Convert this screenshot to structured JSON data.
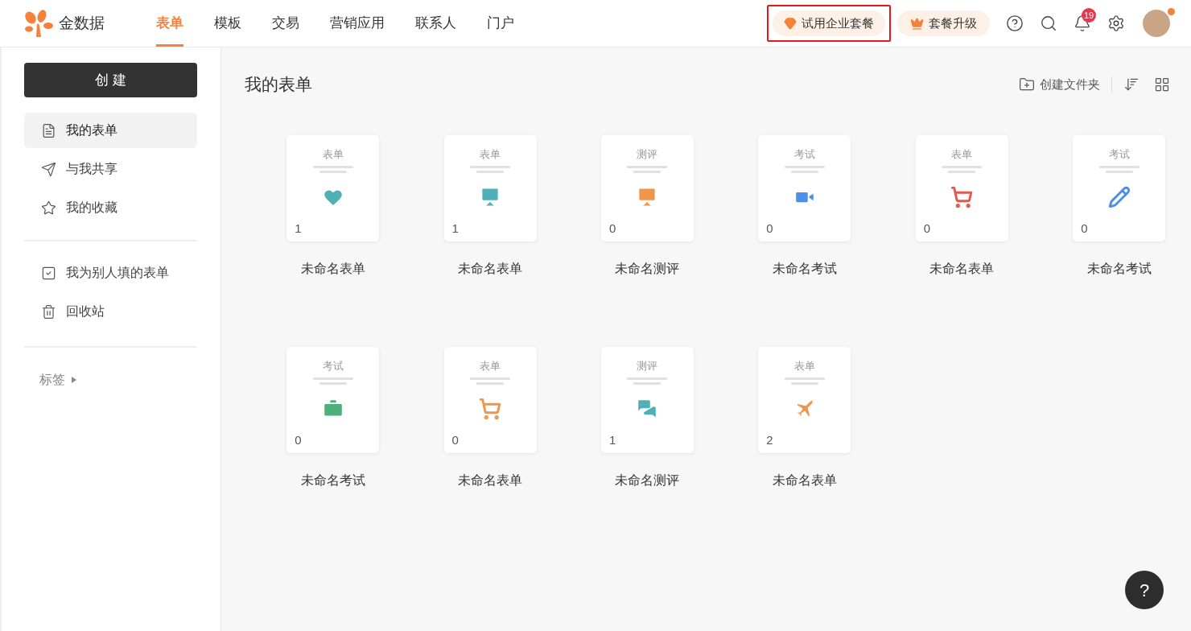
{
  "header": {
    "brand": "金数据",
    "nav": [
      {
        "label": "表单",
        "selected": true
      },
      {
        "label": "模板",
        "selected": false
      },
      {
        "label": "交易",
        "selected": false
      },
      {
        "label": "营销应用",
        "selected": false
      },
      {
        "label": "联系人",
        "selected": false
      },
      {
        "label": "门户",
        "selected": false
      }
    ],
    "trial_button": {
      "label": "试用企业套餐",
      "highlighted": true
    },
    "upgrade_button": {
      "label": "套餐升级"
    },
    "notification_count": "19",
    "avatar_dot": true
  },
  "sidebar": {
    "create_button": "创 建",
    "groups": [
      [
        {
          "label": "我的表单",
          "selected": true
        },
        {
          "label": "与我共享",
          "selected": false
        },
        {
          "label": "我的收藏",
          "selected": false
        }
      ],
      [
        {
          "label": "我为别人填的表单",
          "selected": false
        },
        {
          "label": "回收站",
          "selected": false
        }
      ]
    ],
    "tags_label": "标签"
  },
  "main": {
    "title": "我的表单",
    "new_folder": "创建文件夹",
    "forms": [
      {
        "type": "表单",
        "kind": "hearts",
        "color": "#4fb0b8",
        "count": "1",
        "name": "未命名表单"
      },
      {
        "type": "表单",
        "kind": "board",
        "color": "#4fb0b8",
        "count": "1",
        "name": "未命名表单"
      },
      {
        "type": "测评",
        "kind": "board",
        "color": "#f0964a",
        "count": "0",
        "name": "未命名测评"
      },
      {
        "type": "考试",
        "kind": "video",
        "color": "#4d8fe8",
        "count": "0",
        "name": "未命名考试"
      },
      {
        "type": "表单",
        "kind": "cart",
        "color": "#e05a4f",
        "count": "0",
        "name": "未命名表单"
      },
      {
        "type": "考试",
        "kind": "pencil",
        "color": "#4d8fe8",
        "count": "0",
        "name": "未命名考试"
      },
      {
        "type": "考试",
        "kind": "briefcase",
        "color": "#4cb07a",
        "count": "0",
        "name": "未命名考试"
      },
      {
        "type": "表单",
        "kind": "cart",
        "color": "#f0964a",
        "count": "0",
        "name": "未命名表单"
      },
      {
        "type": "测评",
        "kind": "chat",
        "color": "#4fb0b8",
        "count": "1",
        "name": "未命名测评"
      },
      {
        "type": "表单",
        "kind": "plane",
        "color": "#f0964a",
        "count": "2",
        "name": "未命名表单"
      }
    ]
  },
  "help_button": "?"
}
